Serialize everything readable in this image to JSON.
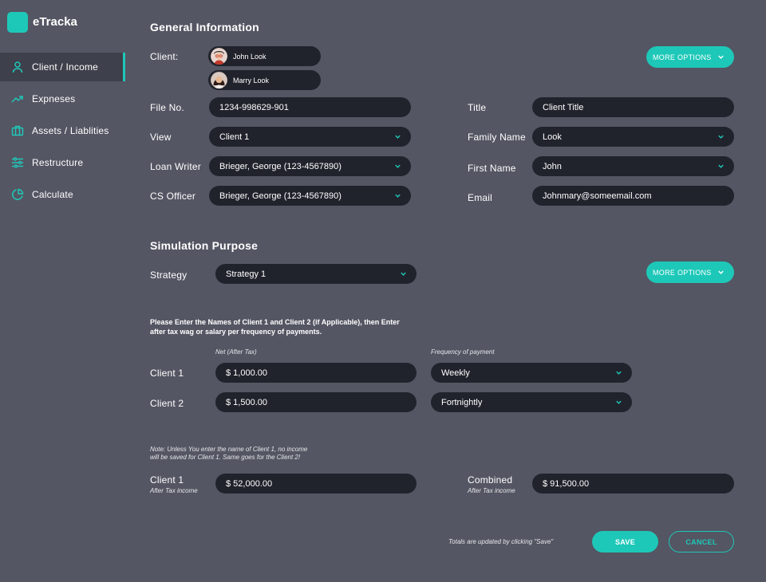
{
  "app": {
    "name": "eTracka"
  },
  "colors": {
    "accent": "#1ec8b8",
    "background": "#545663",
    "field": "#21232c",
    "active_nav": "#3e404b"
  },
  "sidebar": {
    "items": [
      {
        "label": "Client / Income",
        "icon": "person-icon",
        "active": true
      },
      {
        "label": "Expneses",
        "icon": "trend-up-icon",
        "active": false
      },
      {
        "label": "Assets / Liablities",
        "icon": "briefcase-icon",
        "active": false
      },
      {
        "label": "Restructure",
        "icon": "sliders-icon",
        "active": false
      },
      {
        "label": "Calculate",
        "icon": "pie-chart-icon",
        "active": false
      }
    ]
  },
  "general": {
    "title": "General Information",
    "client_label": "Client:",
    "clients": [
      "John Look",
      "Marry Look"
    ],
    "more_options": "MORE OPTIONS",
    "file_no": {
      "label": "File No.",
      "value": "1234-998629-901"
    },
    "view": {
      "label": "View",
      "value": "Client 1"
    },
    "loan_writer": {
      "label": "Loan Writer",
      "value": "Brieger, George (123-4567890)"
    },
    "cs_officer": {
      "label": "CS Officer",
      "value": "Brieger, George (123-4567890)"
    },
    "title_field": {
      "label": "Title",
      "value": "Client Title"
    },
    "family_name": {
      "label": "Family Name",
      "value": "Look"
    },
    "first_name": {
      "label": "First Name",
      "value": "John"
    },
    "email": {
      "label": "Email",
      "value": "Johnmary@someemail.com"
    }
  },
  "simulation": {
    "title": "Simulation Purpose",
    "strategy": {
      "label": "Strategy",
      "value": "Strategy 1"
    },
    "more_options": "MORE OPTIONS",
    "instructions_line1": "Please Enter the Names of Client 1 and Client 2 (if Applicable), then Enter",
    "instructions_line2": "after tax wag or salary per frequency of payments.",
    "net_header": "Net (After Tax)",
    "freq_header": "Frequency of payment",
    "rows": [
      {
        "label": "Client 1",
        "net": "$ 1,000.00",
        "frequency": "Weekly"
      },
      {
        "label": "Client 2",
        "net": "$ 1,500.00",
        "frequency": "Fortnightly"
      }
    ],
    "note_line1": "Note: Unless You enter the name of Client 1, no income",
    "note_line2": "will be saved for Client 1. Same goes for the Client 2!",
    "client1_total": {
      "label": "Client 1",
      "sublabel": "After Tax income",
      "value": "$ 52,000.00"
    },
    "combined_total": {
      "label": "Combined",
      "sublabel": "After Tax income",
      "value": "$ 91,500.00"
    }
  },
  "footer": {
    "hint": "Totals are updated by clicking \"Save\"",
    "save": "SAVE",
    "cancel": "CANCEL"
  }
}
